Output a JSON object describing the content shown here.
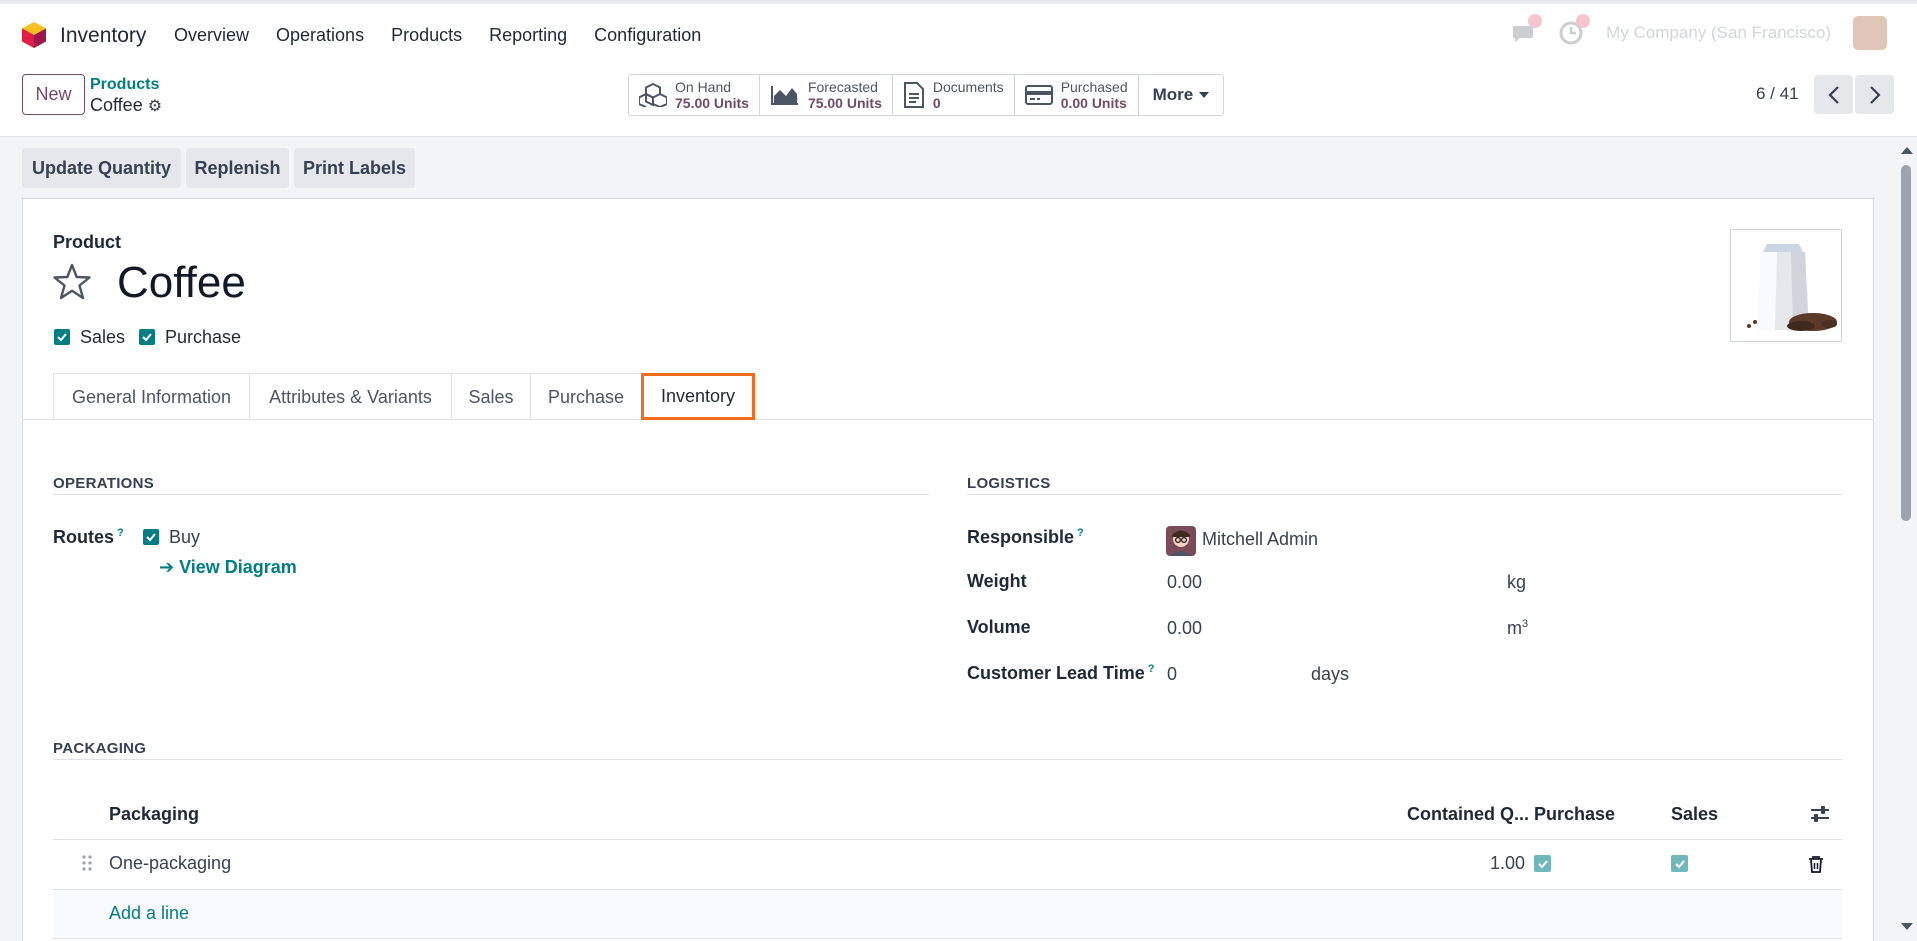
{
  "navbar": {
    "app_name": "Inventory",
    "menu": [
      "Overview",
      "Operations",
      "Products",
      "Reporting",
      "Configuration"
    ],
    "company": "My Company (San Francisco)"
  },
  "control_panel": {
    "new_label": "New",
    "breadcrumb_parent": "Products",
    "breadcrumb_current": "Coffee",
    "stats": [
      {
        "label": "On Hand",
        "value": "75.00 Units",
        "icon": "cubes-icon"
      },
      {
        "label": "Forecasted",
        "value": "75.00 Units",
        "icon": "area-chart-icon"
      },
      {
        "label": "Documents",
        "value": "0",
        "icon": "file-icon"
      },
      {
        "label": "Purchased",
        "value": "0.00 Units",
        "icon": "credit-card-icon"
      }
    ],
    "more_label": "More",
    "pager": "6 / 41"
  },
  "actions": [
    "Update Quantity",
    "Replenish",
    "Print Labels"
  ],
  "product": {
    "label": "Product",
    "name": "Coffee",
    "can_be_sold_label": "Sales",
    "can_be_purchased_label": "Purchase",
    "sales_checked": true,
    "purchase_checked": true
  },
  "tabs": [
    "General Information",
    "Attributes & Variants",
    "Sales",
    "Purchase",
    "Inventory"
  ],
  "active_tab": "Inventory",
  "operations": {
    "title": "OPERATIONS",
    "routes_label": "Routes",
    "route_buy": "Buy",
    "view_diagram": "View Diagram"
  },
  "logistics": {
    "title": "LOGISTICS",
    "responsible_label": "Responsible",
    "responsible_value": "Mitchell Admin",
    "weight_label": "Weight",
    "weight_value": "0.00",
    "weight_unit": "kg",
    "volume_label": "Volume",
    "volume_value": "0.00",
    "volume_unit": "m",
    "volume_unit_sup": "3",
    "lead_time_label": "Customer Lead Time",
    "lead_time_value": "0",
    "lead_time_unit": "days"
  },
  "packaging": {
    "title": "PACKAGING",
    "columns": [
      "Packaging",
      "Contained Q...",
      "Purchase",
      "Sales"
    ],
    "rows": [
      {
        "name": "One-packaging",
        "qty": "1.00",
        "purchase": true,
        "sales": true
      }
    ],
    "add_line": "Add a line"
  },
  "colors": {
    "brand": "#714B67",
    "accent": "#017e84",
    "highlight": "#f26c1b"
  }
}
